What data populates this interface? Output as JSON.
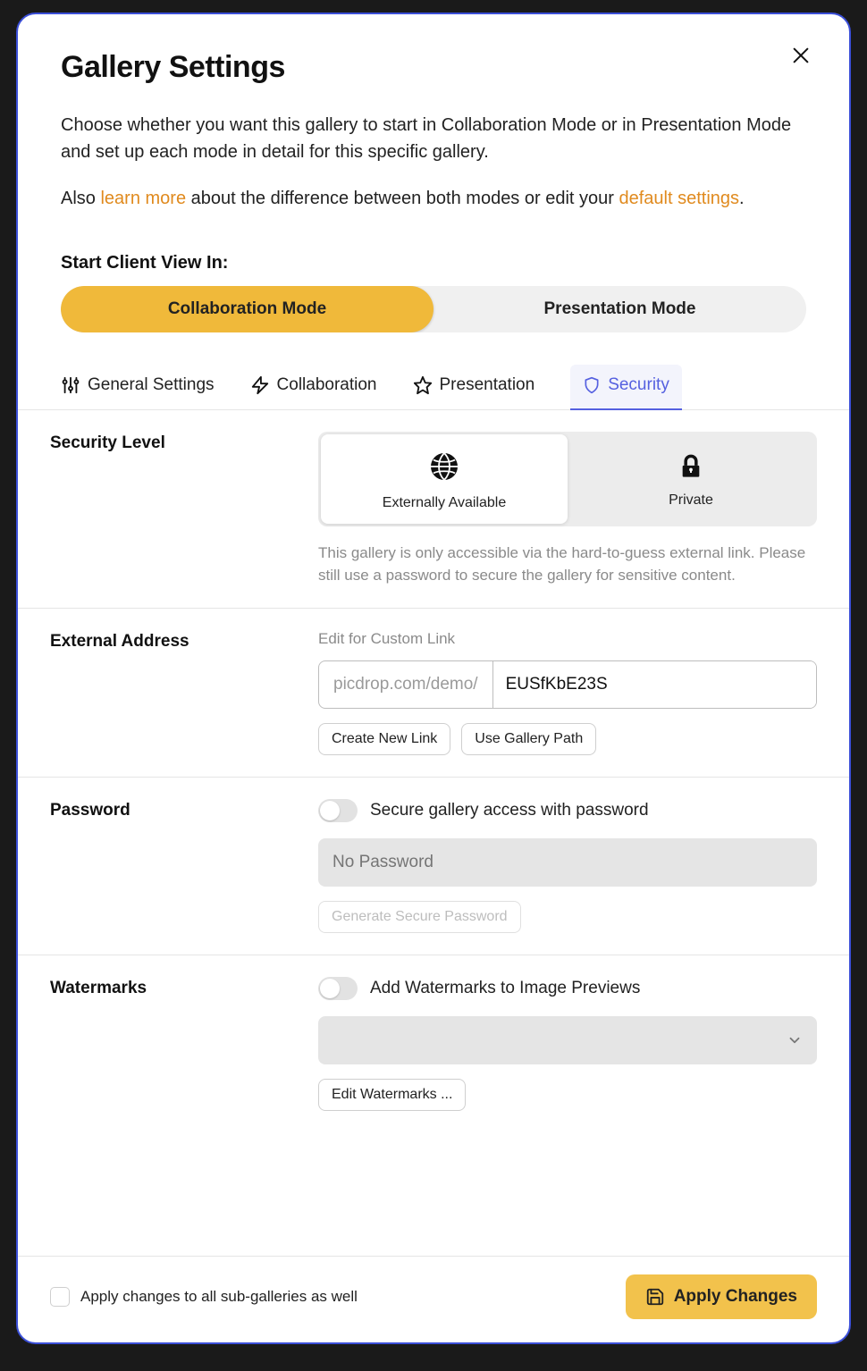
{
  "modal": {
    "title": "Gallery Settings",
    "desc_line1": "Choose whether you want this gallery to start in Collaboration Mode or in Presentation Mode and set up each mode in detail for this specific gallery.",
    "desc_line2_pre": "Also ",
    "desc_line2_link1": "learn more",
    "desc_line2_mid": " about the difference between both modes or edit your ",
    "desc_line2_link2": "default settings",
    "desc_line2_post": "."
  },
  "start_view": {
    "label": "Start Client View In:",
    "options": [
      "Collaboration Mode",
      "Presentation Mode"
    ],
    "active_index": 0
  },
  "tabs": {
    "items": [
      "General Settings",
      "Collaboration",
      "Presentation",
      "Security"
    ],
    "active_index": 3
  },
  "security_level": {
    "label": "Security Level",
    "options": [
      {
        "label": "Externally Available"
      },
      {
        "label": "Private"
      }
    ],
    "active_index": 0,
    "help": "This gallery is only accessible via the hard-to-guess external link. Please still use a password to secure the gallery for sensitive content."
  },
  "external_address": {
    "label": "External Address",
    "sublabel": "Edit for Custom Link",
    "prefix": "picdrop.com/demo/",
    "value": "EUSfKbE23S",
    "btn_new": "Create New Link",
    "btn_gallery_path": "Use Gallery Path"
  },
  "password": {
    "label": "Password",
    "toggle_label": "Secure gallery access with password",
    "placeholder": "No Password",
    "btn_generate": "Generate Secure Password"
  },
  "watermarks": {
    "label": "Watermarks",
    "toggle_label": "Add Watermarks to Image Previews",
    "btn_edit": "Edit Watermarks ..."
  },
  "footer": {
    "sub_label": "Apply changes to all sub-galleries as well",
    "apply": "Apply Changes"
  }
}
